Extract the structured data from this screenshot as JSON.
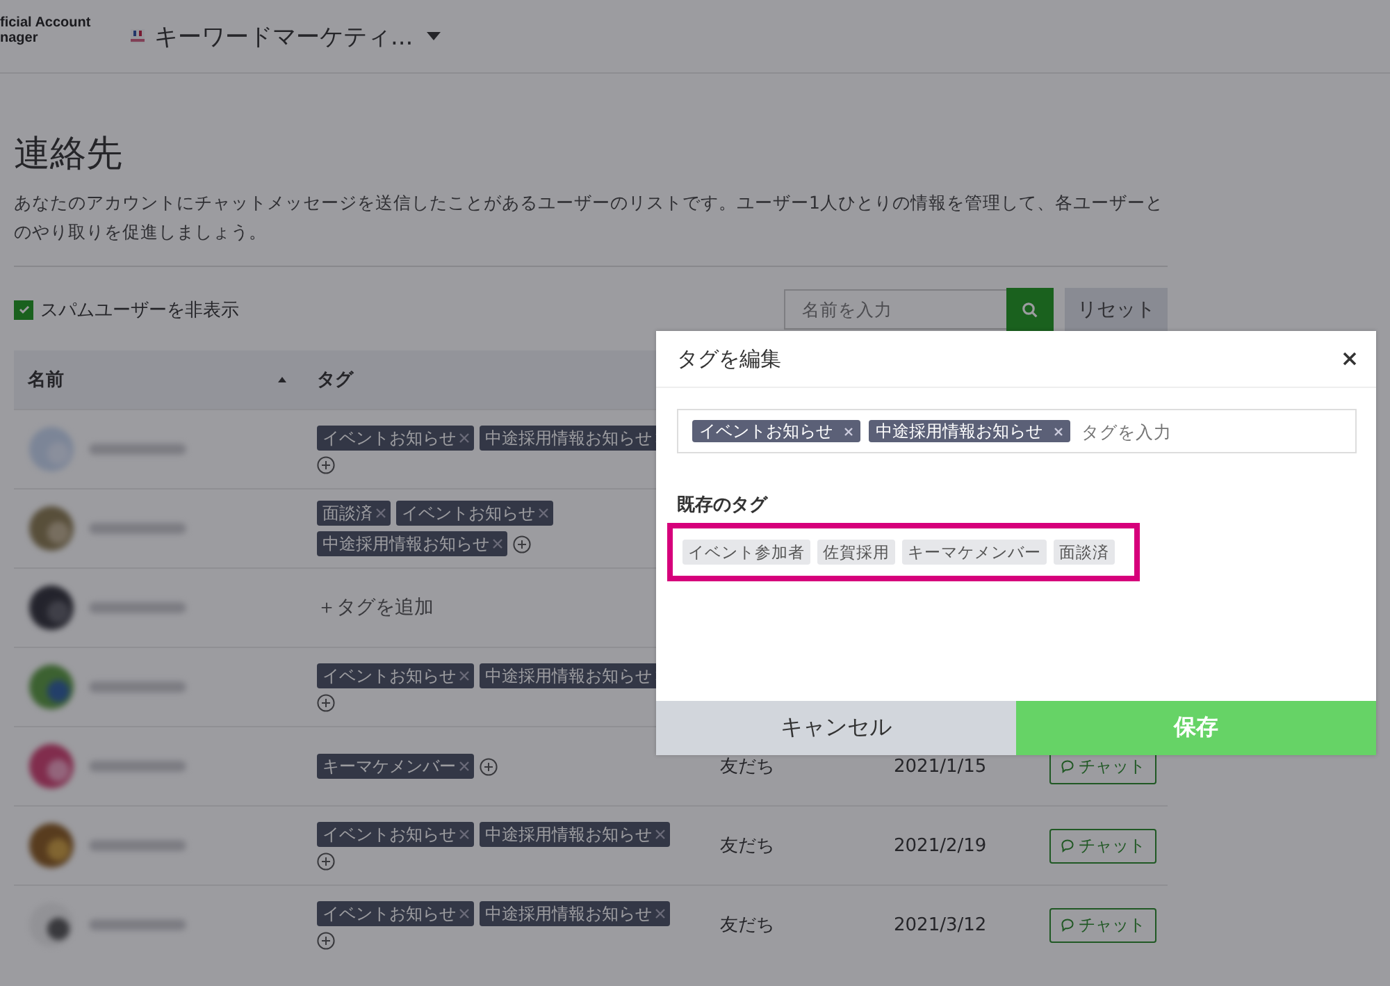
{
  "header": {
    "logo_lines": [
      "ficial Account",
      "nager"
    ],
    "account_name": "キーワードマーケティ..."
  },
  "page": {
    "title": "連絡先",
    "description": "あなたのアカウントにチャットメッセージを送信したことがあるユーザーのリストです。ユーザー1人ひとりの情報を管理して、各ユーザーとのやり取りを促進しましょう。",
    "hide_spam": {
      "label": "スパムユーザーを非表示",
      "checked": true
    },
    "search": {
      "placeholder": "名前を入力"
    },
    "reset_button": "リセット"
  },
  "table": {
    "columns": [
      "名前",
      "タグ"
    ],
    "rows": [
      {
        "tags": [
          "イベントお知らせ",
          "中途採用情報お知らせ"
        ]
      },
      {
        "tags": [
          "面談済",
          "イベントお知らせ",
          "中途採用情報お知らせ"
        ]
      },
      {
        "add_tag_label": "＋タグを追加"
      },
      {
        "tags": [
          "イベントお知らせ",
          "中途採用情報お知らせ"
        ]
      },
      {
        "tags": [
          "キーマケメンバー"
        ],
        "status": "友だち",
        "date": "2021/1/15",
        "chat_button": "チャット"
      },
      {
        "tags": [
          "イベントお知らせ",
          "中途採用情報お知らせ"
        ],
        "status": "友だち",
        "date": "2021/2/19",
        "chat_button": "チャット"
      },
      {
        "tags": [
          "イベントお知らせ",
          "中途採用情報お知らせ"
        ],
        "status": "友だち",
        "date": "2021/3/12",
        "chat_button": "チャット"
      }
    ]
  },
  "dialog": {
    "title": "タグを編集",
    "selected_tags": [
      "イベントお知らせ",
      "中途採用情報お知らせ"
    ],
    "placeholder": "タグを入力",
    "existing_heading": "既存のタグ",
    "existing_tags": [
      "イベント参加者",
      "佐賀採用",
      "キーマケメンバー",
      "面談済"
    ],
    "cancel_button": "キャンセル",
    "save_button": "保存"
  }
}
